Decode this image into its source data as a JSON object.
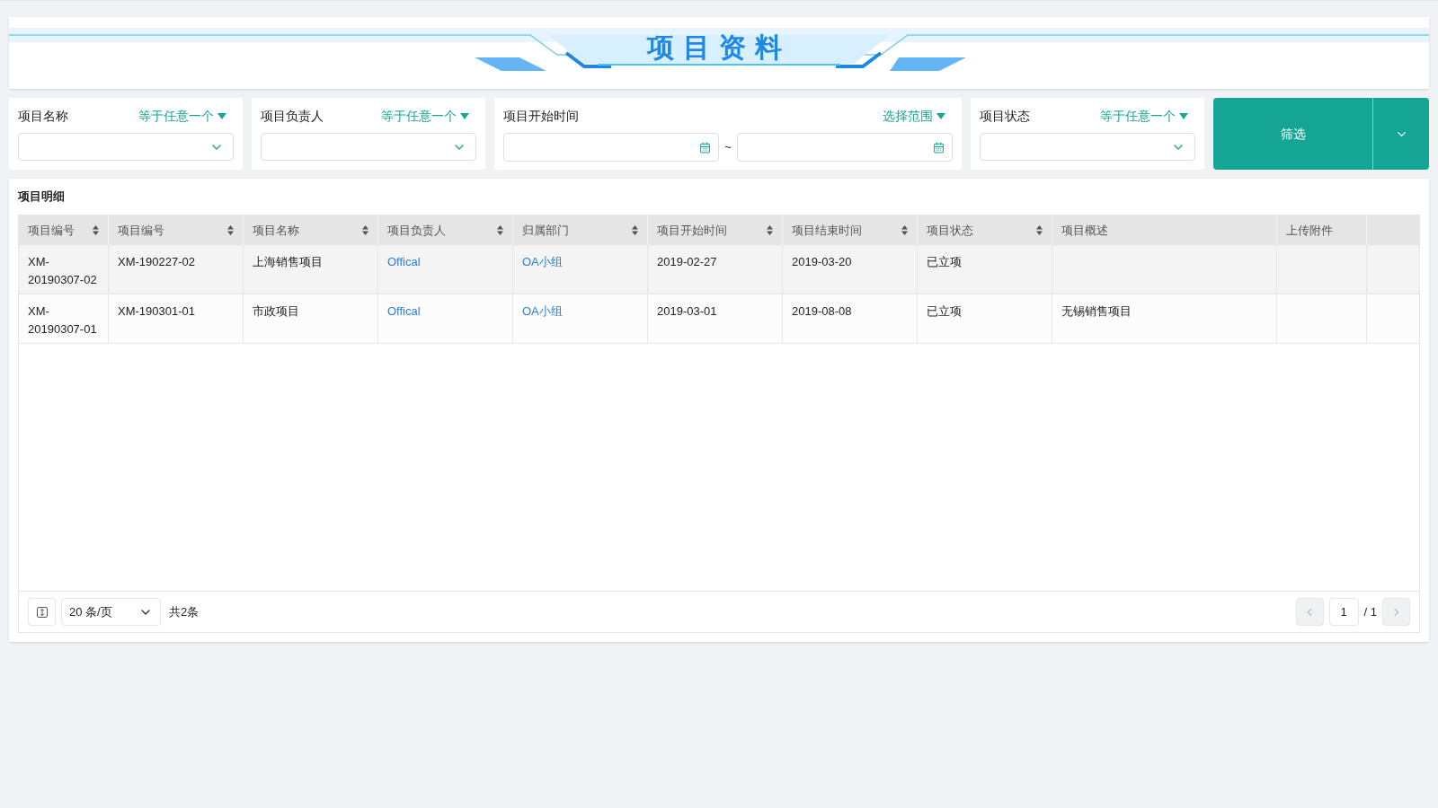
{
  "header": {
    "title": "项目资料"
  },
  "filters": [
    {
      "kind": "select",
      "label": "项目名称",
      "mode": "等于任意一个"
    },
    {
      "kind": "select",
      "label": "项目负责人",
      "mode": "等于任意一个"
    },
    {
      "kind": "daterange",
      "label": "项目开始时间",
      "mode": "选择范围",
      "separator": "~"
    },
    {
      "kind": "select",
      "label": "项目状态",
      "mode": "等于任意一个"
    }
  ],
  "filter_button": {
    "label": "筛选"
  },
  "table": {
    "title": "项目明细",
    "columns": [
      {
        "label": "项目编号",
        "sortable": true
      },
      {
        "label": "项目编号",
        "sortable": true
      },
      {
        "label": "项目名称",
        "sortable": true
      },
      {
        "label": "项目负责人",
        "sortable": true
      },
      {
        "label": "归属部门",
        "sortable": true
      },
      {
        "label": "项目开始时间",
        "sortable": true
      },
      {
        "label": "项目结束时间",
        "sortable": true
      },
      {
        "label": "项目状态",
        "sortable": true
      },
      {
        "label": "项目概述",
        "sortable": false
      },
      {
        "label": "上传附件",
        "sortable": false
      }
    ],
    "rows": [
      {
        "cells": [
          {
            "kind": "text",
            "text": "XM-20190307-02"
          },
          {
            "kind": "text",
            "text": "XM-190227-02"
          },
          {
            "kind": "text",
            "text": "上海销售项目"
          },
          {
            "kind": "link",
            "text": "Offical"
          },
          {
            "kind": "link",
            "text": "OA小组"
          },
          {
            "kind": "text",
            "text": "2019-02-27"
          },
          {
            "kind": "text",
            "text": "2019-03-20"
          },
          {
            "kind": "text",
            "text": "已立项"
          },
          {
            "kind": "empty"
          },
          {
            "kind": "empty"
          }
        ]
      },
      {
        "cells": [
          {
            "kind": "text",
            "text": "XM-20190307-01"
          },
          {
            "kind": "text",
            "text": "XM-190301-01"
          },
          {
            "kind": "text",
            "text": "市政项目"
          },
          {
            "kind": "link",
            "text": "Offical"
          },
          {
            "kind": "link",
            "text": "OA小组"
          },
          {
            "kind": "text",
            "text": "2019-03-01"
          },
          {
            "kind": "text",
            "text": "2019-08-08"
          },
          {
            "kind": "text",
            "text": "已立项"
          },
          {
            "kind": "text",
            "text": "无锡销售项目"
          },
          {
            "kind": "empty"
          }
        ]
      }
    ]
  },
  "pagination": {
    "page_size": "20 条/页",
    "total": "共2条",
    "page": "1",
    "pages": "/ 1"
  }
}
